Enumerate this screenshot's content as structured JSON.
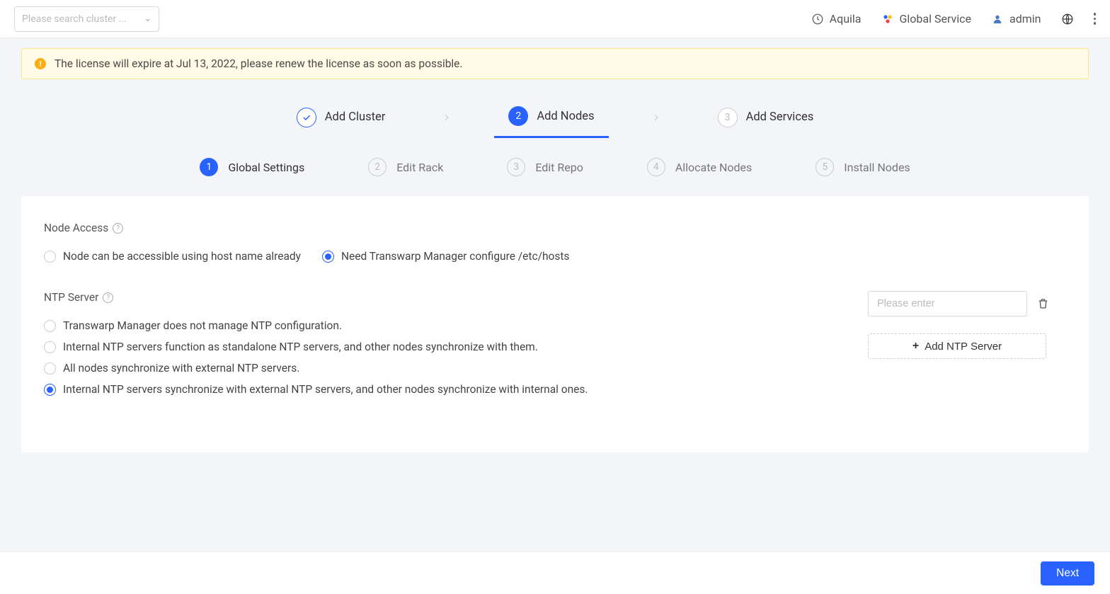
{
  "header": {
    "searchPlaceholder": "Please search cluster ...",
    "aquila": "Aquila",
    "globalService": "Global Service",
    "user": "admin"
  },
  "warning": {
    "text": "The license will expire at Jul 13, 2022, please renew the license as soon as possible."
  },
  "mainSteps": [
    {
      "num": "✓",
      "label": "Add Cluster",
      "state": "done"
    },
    {
      "num": "2",
      "label": "Add Nodes",
      "state": "current"
    },
    {
      "num": "3",
      "label": "Add Services",
      "state": "pending"
    }
  ],
  "subSteps": [
    {
      "num": "1",
      "label": "Global Settings",
      "state": "current"
    },
    {
      "num": "2",
      "label": "Edit Rack",
      "state": "pending"
    },
    {
      "num": "3",
      "label": "Edit Repo",
      "state": "pending"
    },
    {
      "num": "4",
      "label": "Allocate Nodes",
      "state": "pending"
    },
    {
      "num": "5",
      "label": "Install Nodes",
      "state": "pending"
    }
  ],
  "nodeAccess": {
    "title": "Node Access",
    "options": [
      {
        "label": "Node can be accessible using host name already",
        "checked": false
      },
      {
        "label": "Need Transwarp Manager configure /etc/hosts",
        "checked": true
      }
    ]
  },
  "ntpServer": {
    "title": "NTP Server",
    "inputPlaceholder": "Please enter",
    "addButton": "Add NTP Server",
    "options": [
      {
        "label": "Transwarp Manager does not manage NTP configuration.",
        "checked": false
      },
      {
        "label": "Internal NTP servers function as standalone NTP servers, and other nodes synchronize with them.",
        "checked": false
      },
      {
        "label": "All nodes synchronize with external NTP servers.",
        "checked": false
      },
      {
        "label": "Internal NTP servers synchronize with external NTP servers, and other nodes synchronize with internal ones.",
        "checked": true
      }
    ]
  },
  "footer": {
    "next": "Next"
  }
}
